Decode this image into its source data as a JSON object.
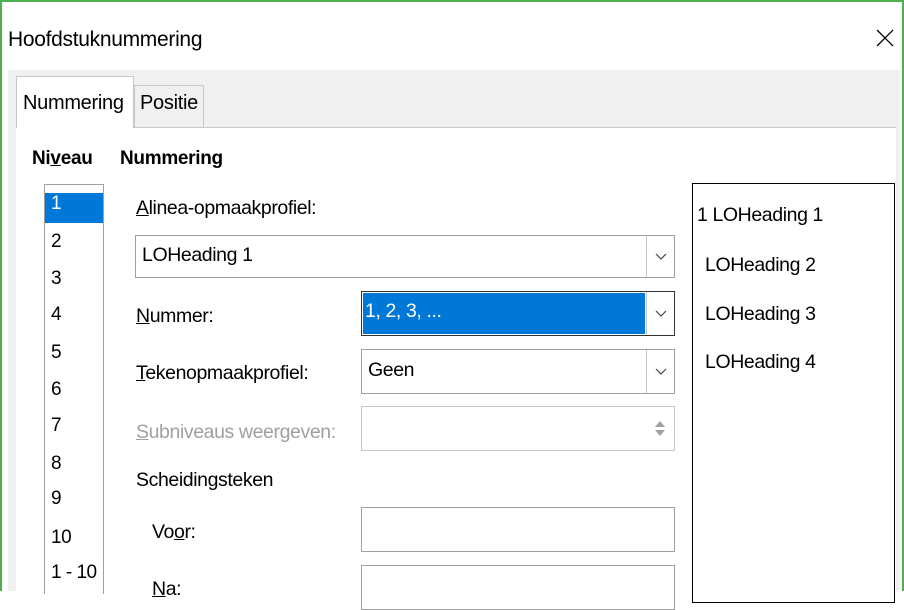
{
  "window": {
    "title": "Hoofdstuknummering"
  },
  "tabs": [
    {
      "label": "Nummering",
      "active": true
    },
    {
      "label": "Positie",
      "active": false
    }
  ],
  "levels": {
    "heading_pre": "Ni",
    "heading_u": "v",
    "heading_post": "eau",
    "items": [
      "1",
      "2",
      "3",
      "4",
      "5",
      "6",
      "7",
      "8",
      "9",
      "10",
      "1 - 10"
    ],
    "selected": "1"
  },
  "numbering": {
    "heading": "Nummering",
    "paragraph_style": {
      "label_u": "A",
      "label_rest": "linea-opmaakprofiel:",
      "value": "LOHeading 1"
    },
    "number": {
      "label_u": "N",
      "label_rest": "ummer:",
      "value": "1, 2, 3, ..."
    },
    "char_style": {
      "label_u": "T",
      "label_rest": "ekenopmaakprofiel:",
      "value": "Geen"
    },
    "sublevels": {
      "label_u": "S",
      "label_rest": "ubniveaus weergeven:"
    },
    "separator": {
      "heading": "Scheidingsteken",
      "before_label_pre": "Vo",
      "before_label_u": "o",
      "before_label_post": "r:",
      "after_label_u": "N",
      "after_label_rest": "a:"
    }
  },
  "preview": [
    "1 LOHeading 1",
    "LOHeading 2",
    "LOHeading 3",
    "LOHeading 4"
  ],
  "colors": {
    "accent": "#0078d7",
    "frame": "#4caf50"
  }
}
